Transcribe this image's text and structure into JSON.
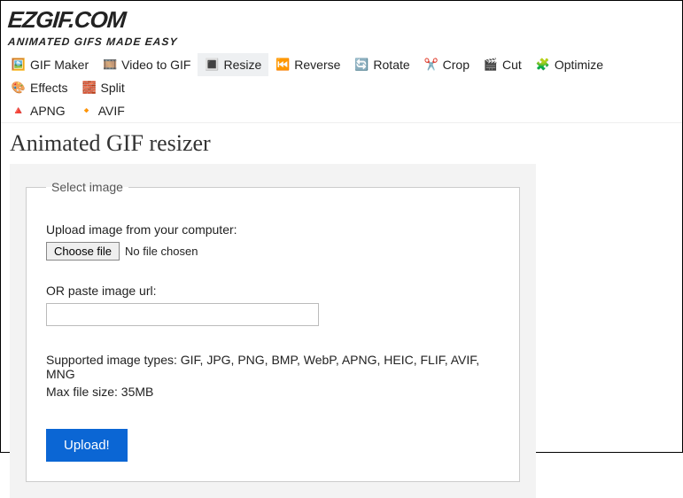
{
  "logo": {
    "main": "EZGIF.COM",
    "sub": "ANIMATED GIFS MADE EASY"
  },
  "nav": {
    "row1": [
      {
        "key": "gif-maker",
        "icon": "🖼️",
        "label": "GIF Maker"
      },
      {
        "key": "video-to-gif",
        "icon": "🎞️",
        "label": "Video to GIF"
      },
      {
        "key": "resize",
        "icon": "🔳",
        "label": "Resize",
        "active": true
      },
      {
        "key": "reverse",
        "icon": "⏮️",
        "label": "Reverse"
      },
      {
        "key": "rotate",
        "icon": "🔄",
        "label": "Rotate"
      },
      {
        "key": "crop",
        "icon": "✂️",
        "label": "Crop"
      },
      {
        "key": "cut",
        "icon": "🎬",
        "label": "Cut"
      },
      {
        "key": "optimize",
        "icon": "🧩",
        "label": "Optimize"
      },
      {
        "key": "effects",
        "icon": "🎨",
        "label": "Effects"
      },
      {
        "key": "split",
        "icon": "🧱",
        "label": "Split"
      }
    ],
    "row2": [
      {
        "key": "apng",
        "icon": "🔺",
        "label": "APNG",
        "icon_color": "#d40000"
      },
      {
        "key": "avif",
        "icon": "🔸",
        "label": "AVIF",
        "icon_color": "#d48800"
      }
    ]
  },
  "page_title": "Animated GIF resizer",
  "form": {
    "legend": "Select image",
    "upload_label": "Upload image from your computer:",
    "choose_file": "Choose file",
    "no_file": "No file chosen",
    "or_label": "OR paste image url:",
    "url_value": "",
    "supported": "Supported image types: GIF, JPG, PNG, BMP, WebP, APNG, HEIC, FLIF, AVIF, MNG",
    "maxsize": "Max file size: 35MB",
    "upload_btn": "Upload!"
  }
}
